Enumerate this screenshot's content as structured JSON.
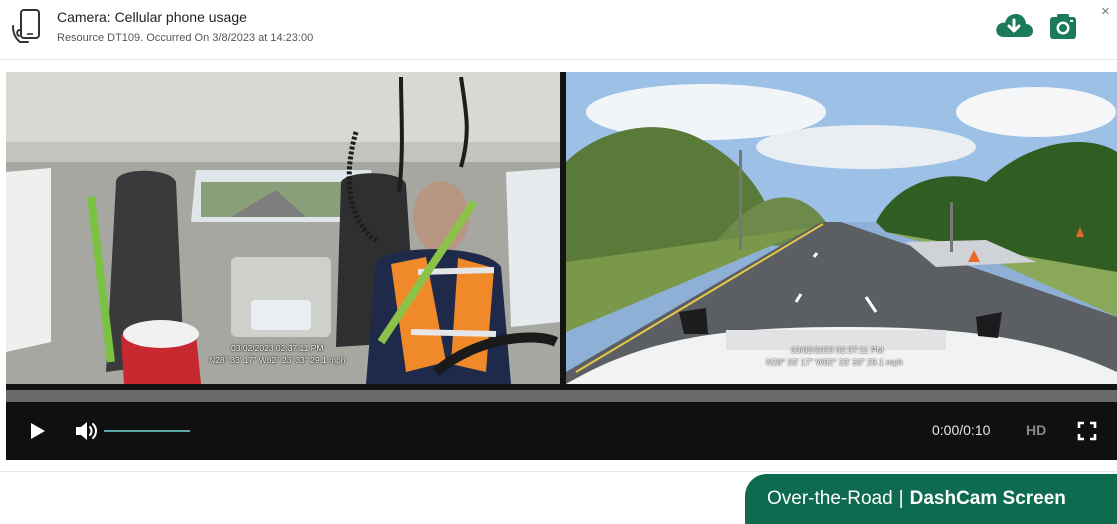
{
  "header": {
    "title": "Camera: Cellular phone usage",
    "subtitle": "Resource DT109. Occurred On 3/8/2023 at 14:23:00",
    "icon": "phone-in-hand-icon",
    "download_icon": "cloud-download-icon",
    "snapshot_icon": "camera-icon",
    "close_label": "×"
  },
  "video": {
    "cab_overlay": {
      "timestamp": "03/02/2023 02:37:11 PM",
      "gps": "N28° 33' 17\" W82° 23' 33\" 29.1 mph"
    },
    "road_overlay": {
      "timestamp": "03/02/2023 02:37:11 PM",
      "gps": "N28° 33' 17\" W82° 23' 33\" 29.1 mph"
    }
  },
  "controls": {
    "time": "0:00/0:10",
    "quality": "HD",
    "play_icon": "play-icon",
    "volume_icon": "volume-icon",
    "fullscreen_icon": "fullscreen-icon",
    "progress": 0,
    "volume": 1
  },
  "banner": {
    "part1": "Over-the-Road",
    "separator": "|",
    "part2": "DashCam Screen"
  },
  "colors": {
    "accent": "#0e6b4f",
    "icon_green": "#1b7a5a",
    "volume_track": "#5aa8a8"
  }
}
